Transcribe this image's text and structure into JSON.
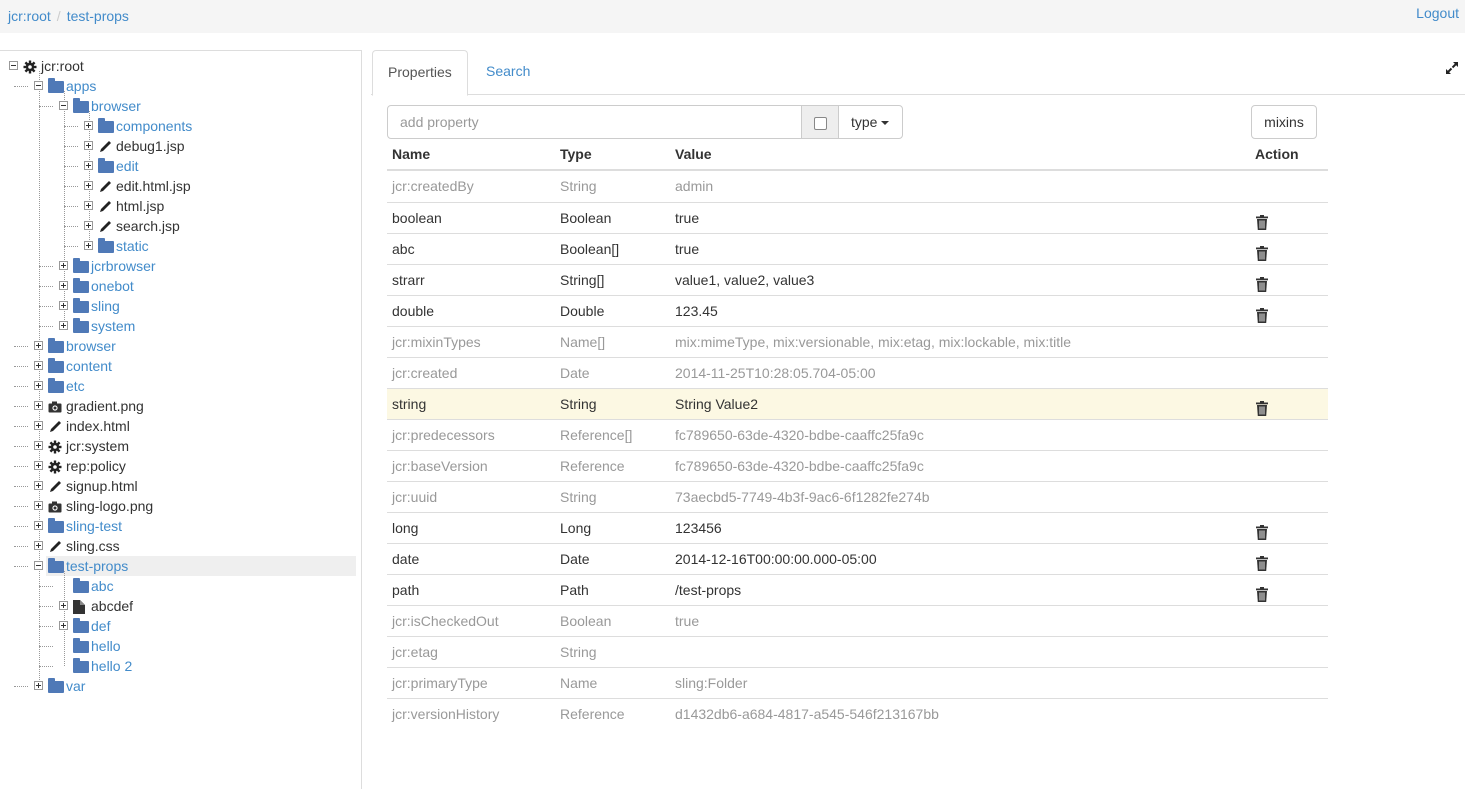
{
  "breadcrumb": {
    "items": [
      "jcr:root",
      "test-props"
    ]
  },
  "header": {
    "logout_label": "Logout"
  },
  "tree": {
    "nodes": [
      {
        "label": "jcr:root",
        "icon": "gear-icon",
        "kind": "file",
        "level": 0,
        "expanded": true
      },
      {
        "label": "apps",
        "icon": "folder-icon",
        "kind": "folder",
        "level": 1,
        "expanded": true
      },
      {
        "label": "browser",
        "icon": "folder-icon",
        "kind": "folder",
        "level": 2,
        "expanded": true
      },
      {
        "label": "components",
        "icon": "folder-icon",
        "kind": "folder",
        "level": 3,
        "expanded": false
      },
      {
        "label": "debug1.jsp",
        "icon": "pencil-icon",
        "kind": "file",
        "level": 3,
        "expanded": false
      },
      {
        "label": "edit",
        "icon": "folder-icon",
        "kind": "folder",
        "level": 3,
        "expanded": false
      },
      {
        "label": "edit.html.jsp",
        "icon": "pencil-icon",
        "kind": "file",
        "level": 3,
        "expanded": false
      },
      {
        "label": "html.jsp",
        "icon": "pencil-icon",
        "kind": "file",
        "level": 3,
        "expanded": false
      },
      {
        "label": "search.jsp",
        "icon": "pencil-icon",
        "kind": "file",
        "level": 3,
        "expanded": false
      },
      {
        "label": "static",
        "icon": "folder-icon",
        "kind": "folder",
        "level": 3,
        "expanded": false
      },
      {
        "label": "jcrbrowser",
        "icon": "folder-icon",
        "kind": "folder",
        "level": 2,
        "expanded": false
      },
      {
        "label": "onebot",
        "icon": "folder-icon",
        "kind": "folder",
        "level": 2,
        "expanded": false
      },
      {
        "label": "sling",
        "icon": "folder-icon",
        "kind": "folder",
        "level": 2,
        "expanded": false
      },
      {
        "label": "system",
        "icon": "folder-icon",
        "kind": "folder",
        "level": 2,
        "expanded": false
      },
      {
        "label": "browser",
        "icon": "folder-icon",
        "kind": "folder",
        "level": 1,
        "expanded": false
      },
      {
        "label": "content",
        "icon": "folder-icon",
        "kind": "folder",
        "level": 1,
        "expanded": false
      },
      {
        "label": "etc",
        "icon": "folder-icon",
        "kind": "folder",
        "level": 1,
        "expanded": false
      },
      {
        "label": "gradient.png",
        "icon": "camera-icon",
        "kind": "file",
        "level": 1,
        "expanded": false
      },
      {
        "label": "index.html",
        "icon": "pencil-icon",
        "kind": "file",
        "level": 1,
        "expanded": false
      },
      {
        "label": "jcr:system",
        "icon": "gear-icon",
        "kind": "file",
        "level": 1,
        "expanded": false
      },
      {
        "label": "rep:policy",
        "icon": "gear-icon",
        "kind": "file",
        "level": 1,
        "expanded": false
      },
      {
        "label": "signup.html",
        "icon": "pencil-icon",
        "kind": "file",
        "level": 1,
        "expanded": false
      },
      {
        "label": "sling-logo.png",
        "icon": "camera-icon",
        "kind": "file",
        "level": 1,
        "expanded": false
      },
      {
        "label": "sling-test",
        "icon": "folder-icon",
        "kind": "folder",
        "level": 1,
        "expanded": false
      },
      {
        "label": "sling.css",
        "icon": "pencil-icon",
        "kind": "file",
        "level": 1,
        "expanded": false
      },
      {
        "label": "test-props",
        "icon": "folder-icon",
        "kind": "folder",
        "level": 1,
        "expanded": true,
        "selected": true
      },
      {
        "label": "abc",
        "icon": "folder-icon",
        "kind": "folder",
        "level": 2,
        "leaf": true
      },
      {
        "label": "abcdef",
        "icon": "document-icon",
        "kind": "file",
        "level": 2,
        "expanded": false
      },
      {
        "label": "def",
        "icon": "folder-icon",
        "kind": "folder",
        "level": 2,
        "expanded": false
      },
      {
        "label": "hello",
        "icon": "folder-icon",
        "kind": "folder",
        "level": 2,
        "leaf": true
      },
      {
        "label": "hello 2",
        "icon": "folder-icon",
        "kind": "folder",
        "level": 2,
        "leaf": true
      },
      {
        "label": "var",
        "icon": "folder-icon",
        "kind": "folder",
        "level": 1,
        "expanded": false
      }
    ]
  },
  "tabs": [
    {
      "label": "Properties",
      "active": true
    },
    {
      "label": "Search",
      "active": false
    }
  ],
  "add_property": {
    "placeholder": "add property",
    "type_label": "type",
    "mixins_label": "mixins"
  },
  "table": {
    "headers": {
      "name": "Name",
      "type": "Type",
      "value": "Value",
      "action": "Action"
    },
    "rows": [
      {
        "name": "jcr:createdBy",
        "type": "String",
        "value": "admin",
        "protected": true
      },
      {
        "name": "boolean",
        "type": "Boolean",
        "value": "true",
        "protected": false
      },
      {
        "name": "abc",
        "type": "Boolean[]",
        "value": "true",
        "protected": false
      },
      {
        "name": "strarr",
        "type": "String[]",
        "value": "value1, value2, value3",
        "protected": false
      },
      {
        "name": "double",
        "type": "Double",
        "value": "123.45",
        "protected": false
      },
      {
        "name": "jcr:mixinTypes",
        "type": "Name[]",
        "value": "mix:mimeType, mix:versionable, mix:etag, mix:lockable, mix:title",
        "protected": true
      },
      {
        "name": "jcr:created",
        "type": "Date",
        "value": "2014-11-25T10:28:05.704-05:00",
        "protected": true
      },
      {
        "name": "string",
        "type": "String",
        "value": "String Value2",
        "protected": false,
        "highlight": true
      },
      {
        "name": "jcr:predecessors",
        "type": "Reference[]",
        "value": "fc789650-63de-4320-bdbe-caaffc25fa9c",
        "protected": true
      },
      {
        "name": "jcr:baseVersion",
        "type": "Reference",
        "value": "fc789650-63de-4320-bdbe-caaffc25fa9c",
        "protected": true
      },
      {
        "name": "jcr:uuid",
        "type": "String",
        "value": "73aecbd5-7749-4b3f-9ac6-6f1282fe274b",
        "protected": true
      },
      {
        "name": "long",
        "type": "Long",
        "value": "123456",
        "protected": false
      },
      {
        "name": "date",
        "type": "Date",
        "value": "2014-12-16T00:00:00.000-05:00",
        "protected": false
      },
      {
        "name": "path",
        "type": "Path",
        "value": "/test-props",
        "protected": false
      },
      {
        "name": "jcr:isCheckedOut",
        "type": "Boolean",
        "value": "true",
        "protected": true
      },
      {
        "name": "jcr:etag",
        "type": "String",
        "value": "",
        "protected": true
      },
      {
        "name": "jcr:primaryType",
        "type": "Name",
        "value": "sling:Folder",
        "protected": true
      },
      {
        "name": "jcr:versionHistory",
        "type": "Reference",
        "value": "d1432db6-a684-4817-a545-546f213167bb",
        "protected": true
      }
    ]
  },
  "colors": {
    "link": "#428bca",
    "folder": "#4f79b7",
    "highlight": "#fcf8e3",
    "muted": "#999999"
  }
}
